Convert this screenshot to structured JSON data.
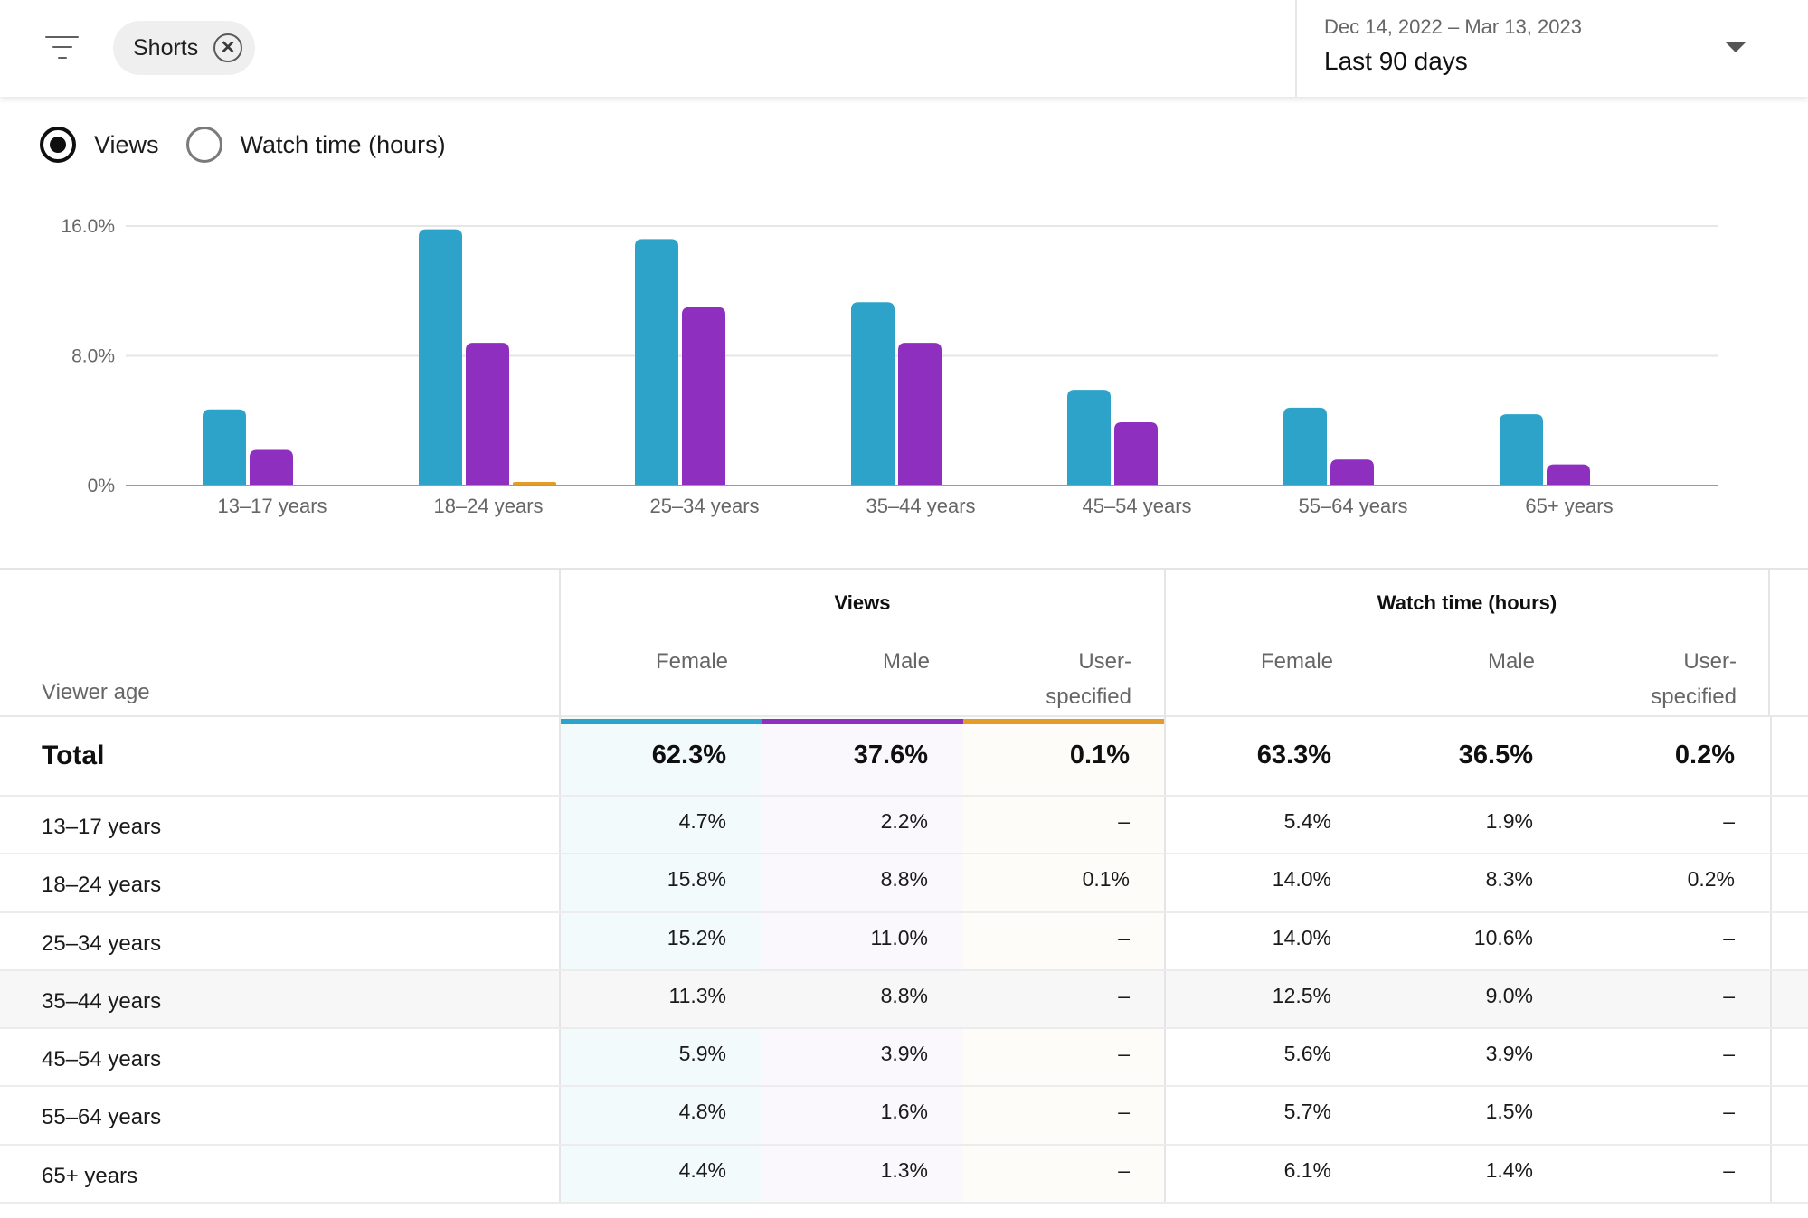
{
  "header": {
    "filter_icon": "filter-list-icon",
    "chip": {
      "label": "Shorts",
      "close_icon": "close-circle-icon",
      "close_glyph": "✕"
    },
    "date_range": "Dec 14, 2022 – Mar 13, 2023",
    "date_preset": "Last 90 days",
    "dropdown_icon": "caret-down-icon"
  },
  "metric_toggle": {
    "options": [
      {
        "label": "Views",
        "selected": true
      },
      {
        "label": "Watch time (hours)",
        "selected": false
      }
    ]
  },
  "colors": {
    "female": "#2ea3c9",
    "male": "#8e2fc0",
    "user_specified": "#e39c2a"
  },
  "chart_data": {
    "type": "bar",
    "title": "",
    "xlabel": "",
    "ylabel": "",
    "ylim": [
      0,
      16
    ],
    "y_ticks": [
      {
        "value": 0,
        "label": "0%"
      },
      {
        "value": 8,
        "label": "8.0%"
      },
      {
        "value": 16,
        "label": "16.0%"
      }
    ],
    "grid": true,
    "categories": [
      "13–17 years",
      "18–24 years",
      "25–34 years",
      "35–44 years",
      "45–54 years",
      "55–64 years",
      "65+ years"
    ],
    "series": [
      {
        "name": "Female",
        "color": "#2ea3c9",
        "values": [
          4.7,
          15.8,
          15.2,
          11.3,
          5.9,
          4.8,
          4.4
        ]
      },
      {
        "name": "Male",
        "color": "#8e2fc0",
        "values": [
          2.2,
          8.8,
          11.0,
          8.8,
          3.9,
          1.6,
          1.3
        ]
      },
      {
        "name": "User-specified",
        "color": "#e39c2a",
        "values": [
          0,
          0.1,
          0,
          0,
          0,
          0,
          0
        ]
      }
    ]
  },
  "table": {
    "age_header": "Viewer age",
    "groups": [
      {
        "title": "Views",
        "columns": [
          "Female",
          "Male",
          "User-\nspecified"
        ]
      },
      {
        "title": "Watch time (hours)",
        "columns": [
          "Female",
          "Male",
          "User-\nspecified"
        ]
      }
    ],
    "total": {
      "label": "Total",
      "values": [
        "62.3%",
        "37.6%",
        "0.1%",
        "63.3%",
        "36.5%",
        "0.2%"
      ]
    },
    "rows": [
      {
        "label": "13–17 years",
        "values": [
          "4.7%",
          "2.2%",
          "–",
          "5.4%",
          "1.9%",
          "–"
        ]
      },
      {
        "label": "18–24 years",
        "values": [
          "15.8%",
          "8.8%",
          "0.1%",
          "14.0%",
          "8.3%",
          "0.2%"
        ]
      },
      {
        "label": "25–34 years",
        "values": [
          "15.2%",
          "11.0%",
          "–",
          "14.0%",
          "10.6%",
          "–"
        ]
      },
      {
        "label": "35–44 years",
        "values": [
          "11.3%",
          "8.8%",
          "–",
          "12.5%",
          "9.0%",
          "–"
        ],
        "hovered": true
      },
      {
        "label": "45–54 years",
        "values": [
          "5.9%",
          "3.9%",
          "–",
          "5.6%",
          "3.9%",
          "–"
        ]
      },
      {
        "label": "55–64 years",
        "values": [
          "4.8%",
          "1.6%",
          "–",
          "5.7%",
          "1.5%",
          "–"
        ]
      },
      {
        "label": "65+ years",
        "values": [
          "4.4%",
          "1.3%",
          "–",
          "6.1%",
          "1.4%",
          "–"
        ]
      }
    ]
  }
}
